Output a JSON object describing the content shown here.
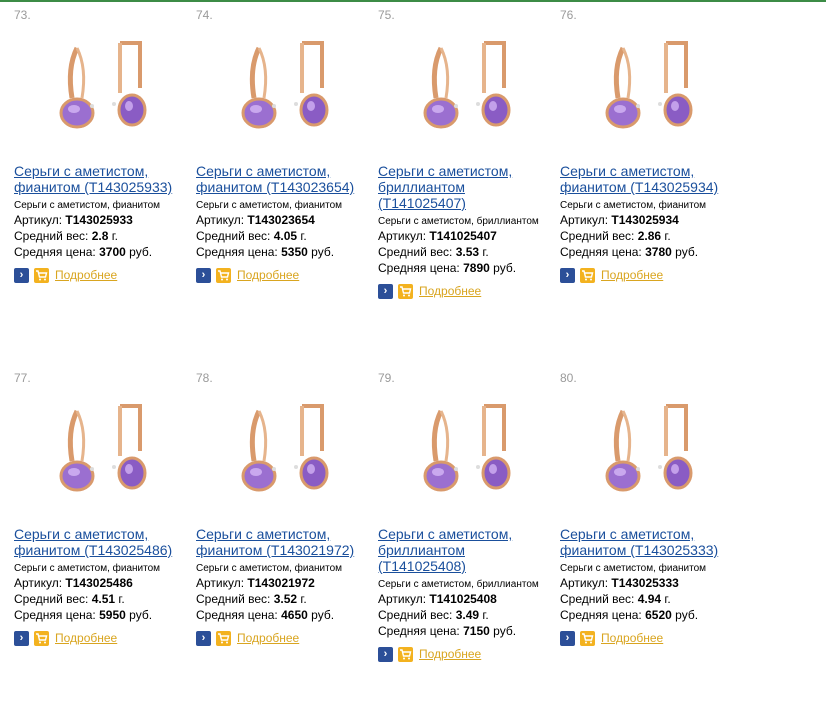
{
  "products": [
    {
      "num": "73.",
      "title": "Серьги с аметистом, фианитом (Т143025933)",
      "sub": "Серьги с аметистом, фианитом",
      "article_label": "Артикул:",
      "article": "Т143025933",
      "weight_label": "Средний вес:",
      "weight": "2.8",
      "weight_unit": "г.",
      "price_label": "Средняя цена:",
      "price": "3700",
      "currency": "руб.",
      "more_label": "Подробнее"
    },
    {
      "num": "74.",
      "title": "Серьги с аметистом, фианитом (Т143023654)",
      "sub": "Серьги с аметистом, фианитом",
      "article_label": "Артикул:",
      "article": "Т143023654",
      "weight_label": "Средний вес:",
      "weight": "4.05",
      "weight_unit": "г.",
      "price_label": "Средняя цена:",
      "price": "5350",
      "currency": "руб.",
      "more_label": "Подробнее"
    },
    {
      "num": "75.",
      "title": "Серьги с аметистом, бриллиантом (Т141025407)",
      "sub": "Серьги с аметистом, бриллиантом",
      "article_label": "Артикул:",
      "article": "Т141025407",
      "weight_label": "Средний вес:",
      "weight": "3.53",
      "weight_unit": "г.",
      "price_label": "Средняя цена:",
      "price": "7890",
      "currency": "руб.",
      "more_label": "Подробнее"
    },
    {
      "num": "76.",
      "title": "Серьги с аметистом, фианитом (Т143025934)",
      "sub": "Серьги с аметистом, фианитом",
      "article_label": "Артикул:",
      "article": "Т143025934",
      "weight_label": "Средний вес:",
      "weight": "2.86",
      "weight_unit": "г.",
      "price_label": "Средняя цена:",
      "price": "3780",
      "currency": "руб.",
      "more_label": "Подробнее"
    },
    {
      "num": "77.",
      "title": "Серьги с аметистом, фианитом (Т143025486)",
      "sub": "Серьги с аметистом, фианитом",
      "article_label": "Артикул:",
      "article": "Т143025486",
      "weight_label": "Средний вес:",
      "weight": "4.51",
      "weight_unit": "г.",
      "price_label": "Средняя цена:",
      "price": "5950",
      "currency": "руб.",
      "more_label": "Подробнее"
    },
    {
      "num": "78.",
      "title": "Серьги с аметистом, фианитом (Т143021972)",
      "sub": "Серьги с аметистом, фианитом",
      "article_label": "Артикул:",
      "article": "Т143021972",
      "weight_label": "Средний вес:",
      "weight": "3.52",
      "weight_unit": "г.",
      "price_label": "Средняя цена:",
      "price": "4650",
      "currency": "руб.",
      "more_label": "Подробнее"
    },
    {
      "num": "79.",
      "title": "Серьги с аметистом, бриллиантом (Т141025408)",
      "sub": "Серьги с аметистом, бриллиантом",
      "article_label": "Артикул:",
      "article": "Т141025408",
      "weight_label": "Средний вес:",
      "weight": "3.49",
      "weight_unit": "г.",
      "price_label": "Средняя цена:",
      "price": "7150",
      "currency": "руб.",
      "more_label": "Подробнее"
    },
    {
      "num": "80.",
      "title": "Серьги с аметистом, фианитом (Т143025333)",
      "sub": "Серьги с аметистом, фианитом",
      "article_label": "Артикул:",
      "article": "Т143025333",
      "weight_label": "Средний вес:",
      "weight": "4.94",
      "weight_unit": "г.",
      "price_label": "Средняя цена:",
      "price": "6520",
      "currency": "руб.",
      "more_label": "Подробнее"
    }
  ],
  "colors": {
    "link": "#1a4f9c",
    "more": "#d9a520",
    "compare_icon": "#2c4f98",
    "cart_icon": "#f3b21f",
    "gold": "#d99a6c",
    "amethyst": "#9b6fd0",
    "frame_line": "#3c8c46"
  },
  "icons": {
    "compare": "arrow-right-icon",
    "cart": "cart-icon"
  }
}
